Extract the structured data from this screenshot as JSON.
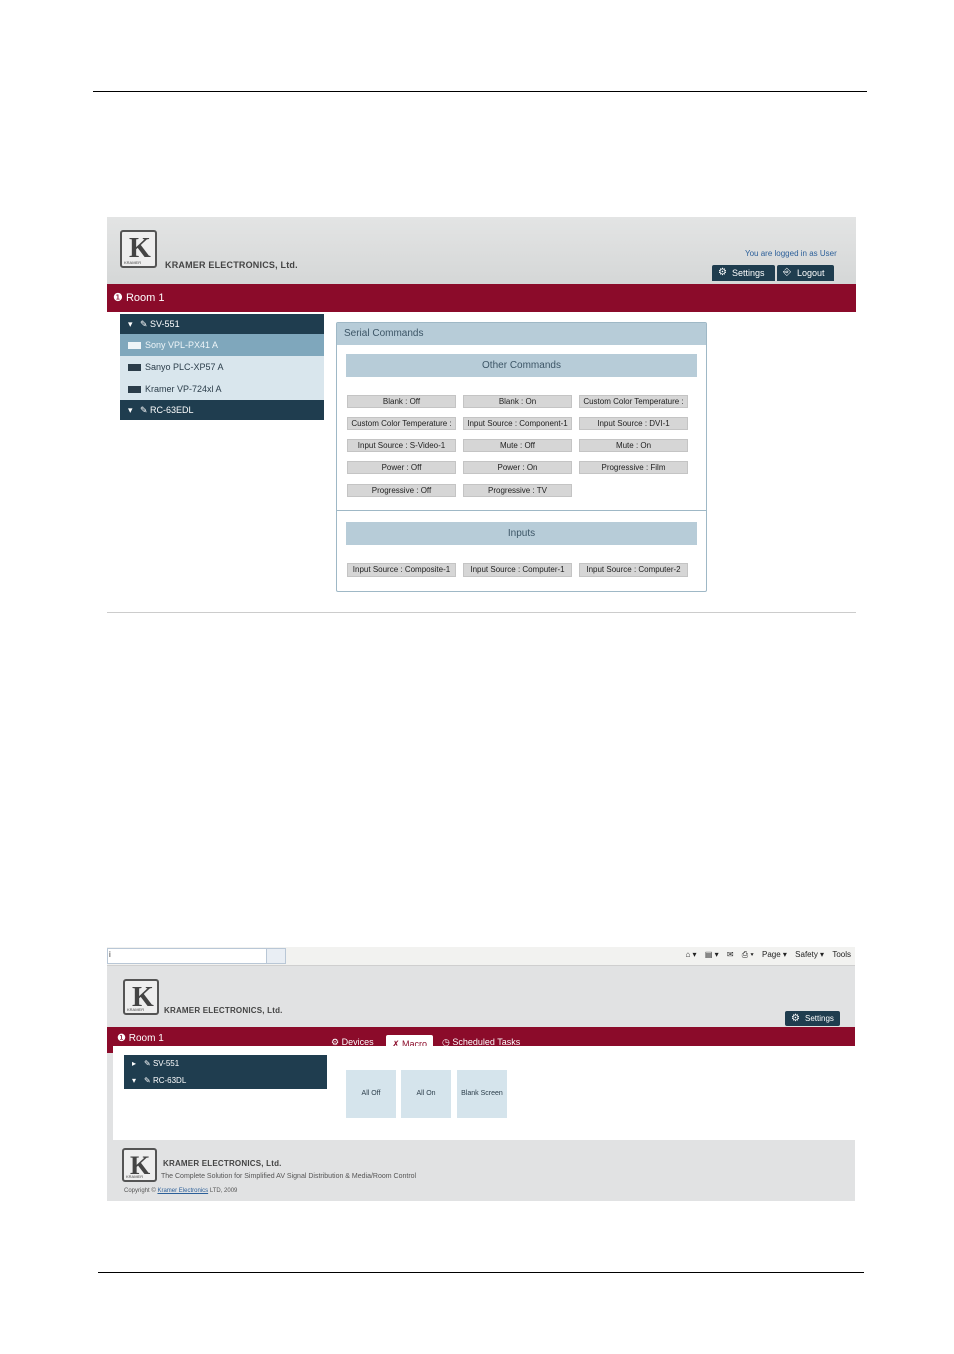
{
  "s1": {
    "brand": "KRAMER ELECTRONICS, Ltd.",
    "logo_letter": "K",
    "logo_sub": "KRAMER",
    "logged_in": "You are logged in as User",
    "settings_label": "Settings",
    "logout_label": "Logout",
    "room_title": "Room 1",
    "tree": {
      "device1": "SV-551",
      "sub1": "Sony VPL-PX41 A",
      "sub2": "Sanyo PLC-XP57 A",
      "sub3": "Kramer VP-724xl A",
      "device2": "RC-63EDL"
    },
    "panel_title": "Serial Commands",
    "other_commands_title": "Other Commands",
    "other_commands": [
      "Blank : Off",
      "Blank : On",
      "Custom Color Temperature :",
      "Custom Color Temperature :",
      "Input Source : Component-1",
      "Input Source : DVI-1",
      "Input Source : S-Video-1",
      "Mute : Off",
      "Mute : On",
      "Power : Off",
      "Power : On",
      "Progressive : Film",
      "Progressive : Off",
      "Progressive : TV"
    ],
    "inputs_title": "Inputs",
    "inputs": [
      "Input Source : Composite-1",
      "Input Source : Computer-1",
      "Input Source : Computer-2"
    ]
  },
  "s2": {
    "ie_addr_prefix": "i",
    "ie_tools": {
      "page": "Page ▾",
      "safety": "Safety ▾",
      "tools": "Tools"
    },
    "brand": "KRAMER ELECTRONICS, Ltd.",
    "logo_letter": "K",
    "logo_sub": "KRAMER",
    "settings_label": "Settings",
    "room_title": "Room 1",
    "tabs": {
      "devices": "Devices",
      "macro": "Macro",
      "scheduled": "Scheduled Tasks"
    },
    "tree": {
      "device1": "SV-551",
      "device2": "RC-63DL"
    },
    "macros": [
      "All Off",
      "All On",
      "Blank Screen"
    ],
    "footer_brand": "KRAMER ELECTRONICS, Ltd.",
    "footer_tagline": "The Complete Solution for Simplified AV Signal Distribution & Media/Room Control",
    "copyright_prefix": "Copyright ©",
    "copyright_link": "Kramer Electronics",
    "copyright_suffix": "LTD, 2009"
  }
}
